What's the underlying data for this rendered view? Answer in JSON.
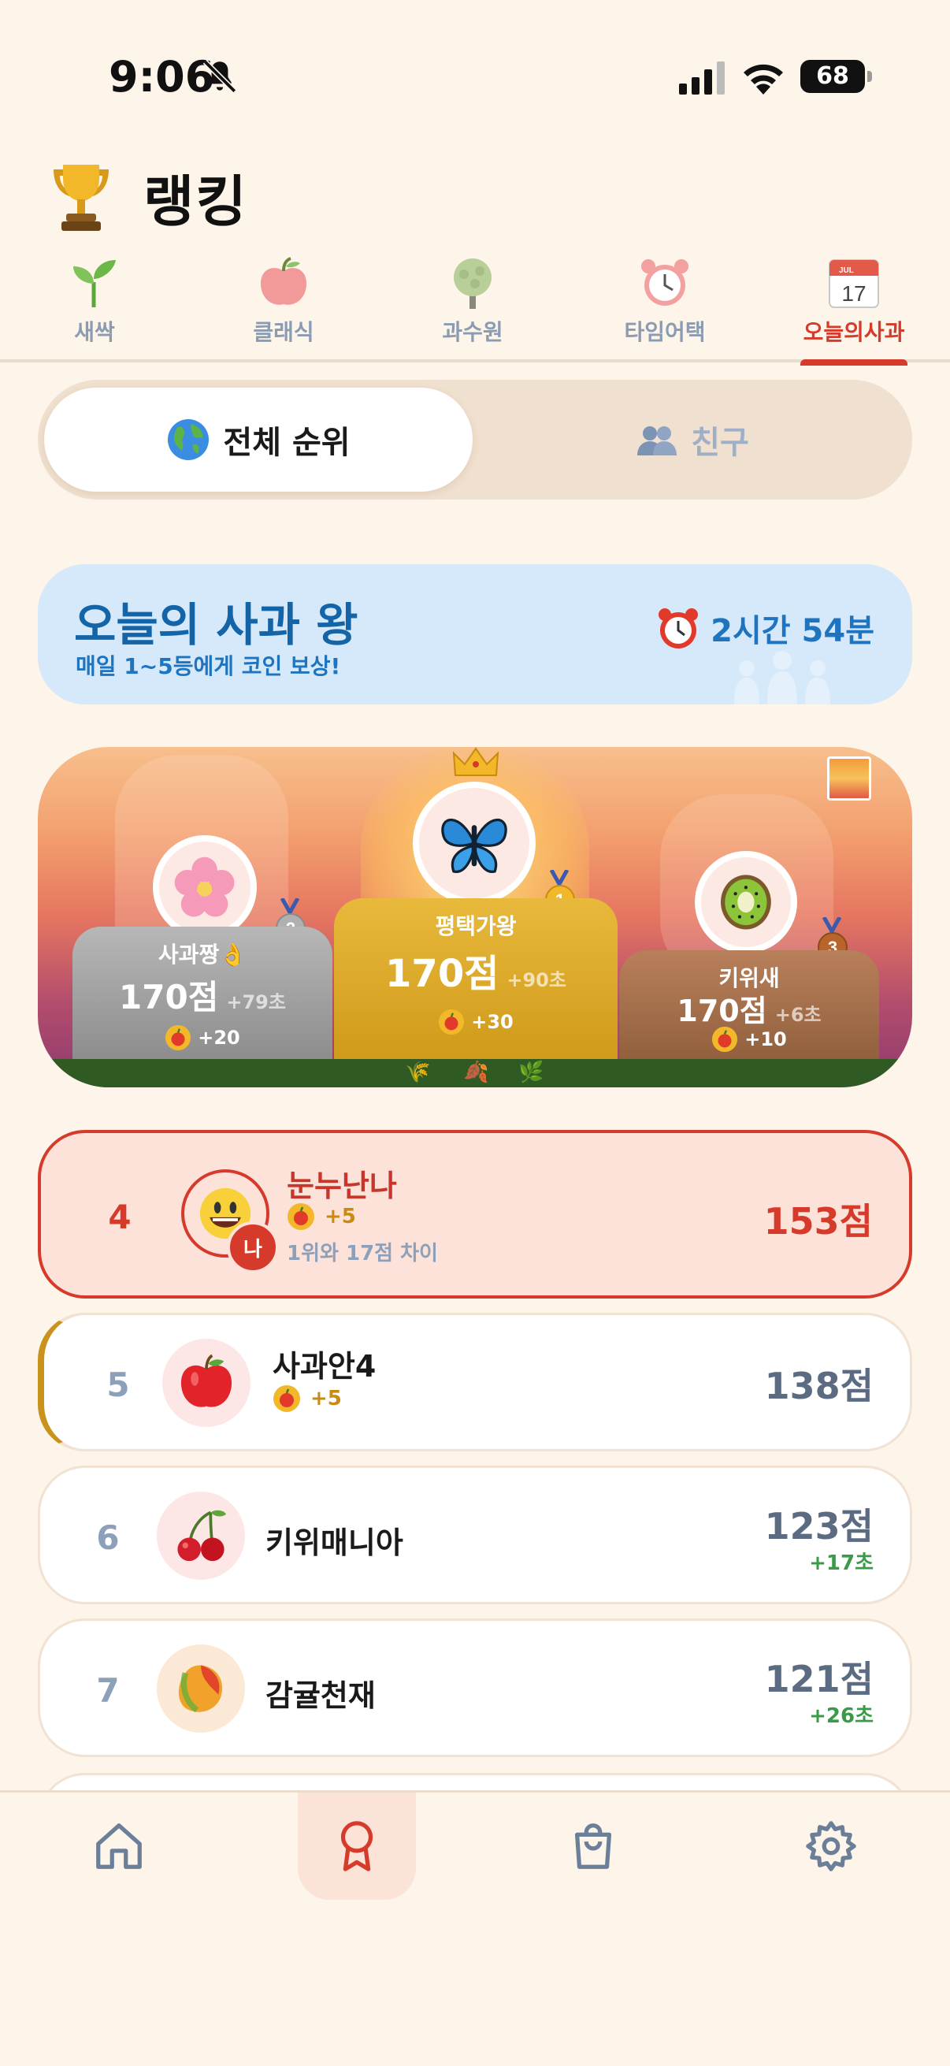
{
  "status_bar": {
    "time": "9:06",
    "battery": "68"
  },
  "header": {
    "title": "랭킹",
    "icon": "trophy-icon"
  },
  "mode_tabs": [
    {
      "label": "새싹",
      "icon": "sprout-icon"
    },
    {
      "label": "클래식",
      "icon": "apple-icon"
    },
    {
      "label": "과수원",
      "icon": "tree-icon"
    },
    {
      "label": "타임어택",
      "icon": "alarm-clock-icon"
    },
    {
      "label": "오늘의사과",
      "icon": "calendar-icon",
      "calendar_month": "JUL",
      "calendar_day": "17",
      "active": true
    }
  ],
  "segment": {
    "all_label": "전체 순위",
    "friends_label": "친구"
  },
  "banner": {
    "title": "오늘의 사과 왕",
    "subtitle": "매일 1~5등에게 코인 보상!",
    "timer": "2시간 54분"
  },
  "podium": {
    "first": {
      "rank": "1",
      "name": "평택가왕",
      "score": "170점",
      "time_bonus": "+90초",
      "coins": "+30",
      "avatar": "butterfly"
    },
    "second": {
      "rank": "2",
      "name": "사과짱👌",
      "score": "170점",
      "time_bonus": "+79초",
      "coins": "+20",
      "avatar": "cherry-blossom"
    },
    "third": {
      "rank": "3",
      "name": "키위새",
      "score": "170점",
      "time_bonus": "+6초",
      "coins": "+10",
      "avatar": "kiwi"
    }
  },
  "ranking": [
    {
      "rank": "4",
      "name": "눈누난나",
      "coins": "+5",
      "gap": "1위와 17점 차이",
      "score": "153점",
      "me_badge": "나",
      "avatar": "smiley"
    },
    {
      "rank": "5",
      "name": "사과안4",
      "coins": "+5",
      "score": "138점",
      "avatar": "apple"
    },
    {
      "rank": "6",
      "name": "키위매니아",
      "score": "123점",
      "bonus": "+17초",
      "avatar": "cherry"
    },
    {
      "rank": "7",
      "name": "감귤천재",
      "score": "121점",
      "bonus": "+26초",
      "avatar": "mango"
    }
  ],
  "bottom_nav": [
    {
      "name": "home",
      "icon": "home-icon"
    },
    {
      "name": "ranking",
      "icon": "award-icon",
      "active": true
    },
    {
      "name": "shop",
      "icon": "shopping-bag-icon"
    },
    {
      "name": "settings",
      "icon": "gear-icon"
    }
  ],
  "colors": {
    "accent": "#d63a2a",
    "background": "#fdf4ea",
    "banner": "#d6e9fb",
    "banner_text": "#1464a8"
  }
}
